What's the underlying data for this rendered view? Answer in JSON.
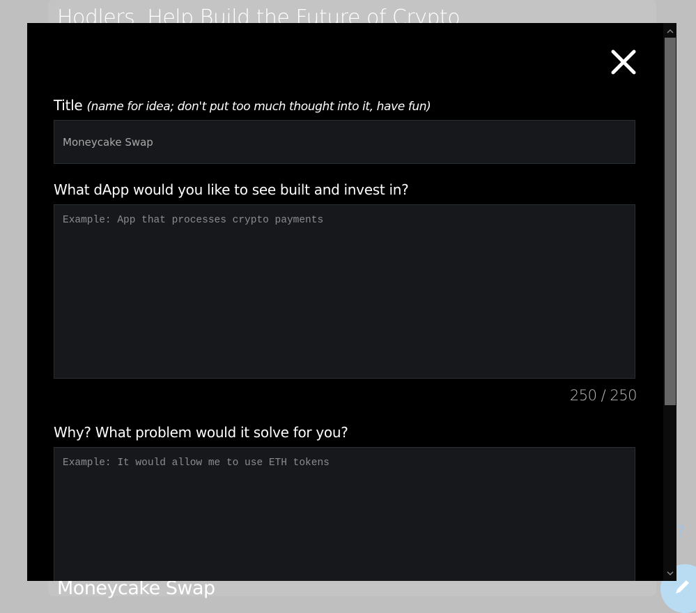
{
  "background": {
    "heading": "Hodlers, Help Build the Future of Crypto",
    "bottom_title": "Moneycake Swap",
    "help_icon": "question-mark-icon",
    "fab_icon": "pencil-icon"
  },
  "modal": {
    "close_icon": "close-icon",
    "title_field": {
      "label": "Title",
      "hint": "(name for idea; don't put too much thought into it, have fun)",
      "value": "Moneycake Swap"
    },
    "dapp_field": {
      "label": "What dApp would you like to see built and invest in?",
      "placeholder": "Example: App that processes crypto payments",
      "counter": "250 / 250"
    },
    "why_field": {
      "label": "Why? What problem would it solve for you?",
      "placeholder": "Example: It would allow me to use ETH tokens"
    }
  },
  "colors": {
    "modal_bg": "#000000",
    "input_bg": "#16181c",
    "page_bg": "#bfbfbf",
    "fab": "#b9dcf3"
  }
}
